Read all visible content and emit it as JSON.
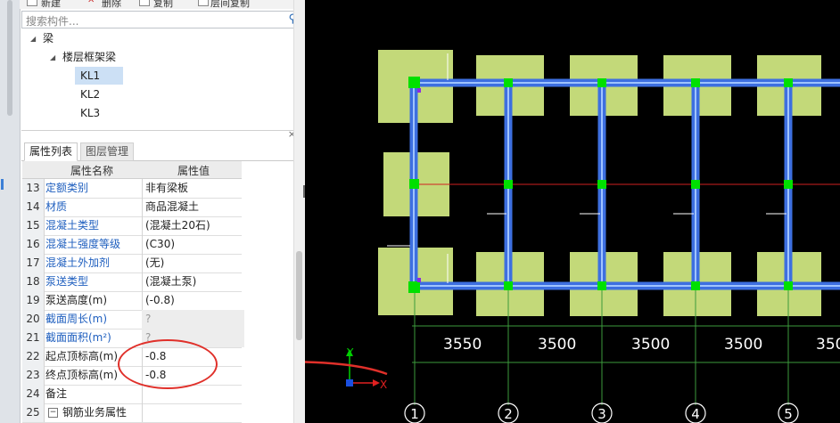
{
  "toolbar": {
    "new_label": "新建",
    "delete_label": "删除",
    "copy_label": "复制",
    "floor_copy_label": "层间复制"
  },
  "search": {
    "placeholder": "搜索构件..."
  },
  "tree": {
    "root": "梁",
    "group": "楼层框架梁",
    "items": [
      "KL1",
      "KL2",
      "KL3"
    ],
    "selected": "KL1"
  },
  "tabs": [
    "属性列表",
    "图层管理"
  ],
  "grid": {
    "header_name": "属性名称",
    "header_value": "属性值",
    "rows": [
      {
        "num": "13",
        "name": "定额类别",
        "value": "非有梁板"
      },
      {
        "num": "14",
        "name": "材质",
        "value": "商品混凝土"
      },
      {
        "num": "15",
        "name": "混凝土类型",
        "value": "(混凝土20石)"
      },
      {
        "num": "16",
        "name": "混凝土强度等级",
        "value": "(C30)"
      },
      {
        "num": "17",
        "name": "混凝土外加剂",
        "value": "(无)"
      },
      {
        "num": "18",
        "name": "泵送类型",
        "value": "(混凝土泵)"
      },
      {
        "num": "19",
        "name": "泵送高度(m)",
        "value": "(-0.8)"
      },
      {
        "num": "20",
        "name": "截面周长(m)",
        "value": "?"
      },
      {
        "num": "21",
        "name": "截面面积(m²)",
        "value": "?"
      },
      {
        "num": "22",
        "name": "起点顶标高(m)",
        "value": "-0.8"
      },
      {
        "num": "23",
        "name": "终点顶标高(m)",
        "value": "-0.8"
      },
      {
        "num": "24",
        "name": "备注",
        "value": ""
      },
      {
        "num": "25",
        "name": "钢筋业务属性",
        "value": ""
      }
    ]
  },
  "cad": {
    "dimensions": [
      "3550",
      "3500",
      "3500",
      "3500",
      "350"
    ],
    "axis_labels": [
      "1",
      "2",
      "3",
      "4",
      "5"
    ],
    "ucs_x": "X",
    "ucs_y": "Y"
  },
  "colors": {
    "cad_bg": "#000000",
    "column_fill": "#c3d979",
    "beam_blue": "#3d6fe0",
    "node_green": "#00e000",
    "annotation_red": "#e0302a",
    "link_blue": "#1f5fbf"
  }
}
